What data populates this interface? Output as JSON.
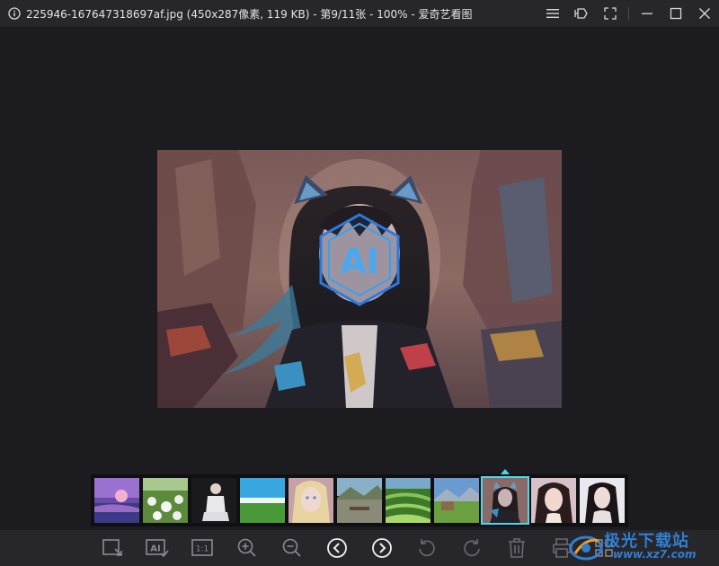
{
  "window": {
    "title": "225946-167647318697af.jpg (450x287像素, 119 KB) - 第9/11张 - 100% - 爱奇艺看图"
  },
  "window_controls": [
    "menu-icon",
    "pin-icon",
    "fullscreen-icon",
    "minimize-icon",
    "maximize-icon",
    "close-icon"
  ],
  "image": {
    "overlay_text": "AI"
  },
  "thumbnails": [
    {
      "name": "purple-sunset-sea"
    },
    {
      "name": "white-flowers"
    },
    {
      "name": "girl-in-white-sitting"
    },
    {
      "name": "green-field-blue-sky"
    },
    {
      "name": "blonde-girl-portrait"
    },
    {
      "name": "lake-with-bench"
    },
    {
      "name": "green-rice-terraces"
    },
    {
      "name": "farmhouse-meadow"
    },
    {
      "name": "ai-cat-girl",
      "active": true
    },
    {
      "name": "long-hair-girl-portrait"
    },
    {
      "name": "dark-hair-girl-portrait"
    }
  ],
  "toolbar": {
    "crop_label": "",
    "ai_label": "AI",
    "actual_size_label": "1:1"
  },
  "watermark": {
    "title": "极光下载站",
    "url": "www.xz7.com"
  }
}
